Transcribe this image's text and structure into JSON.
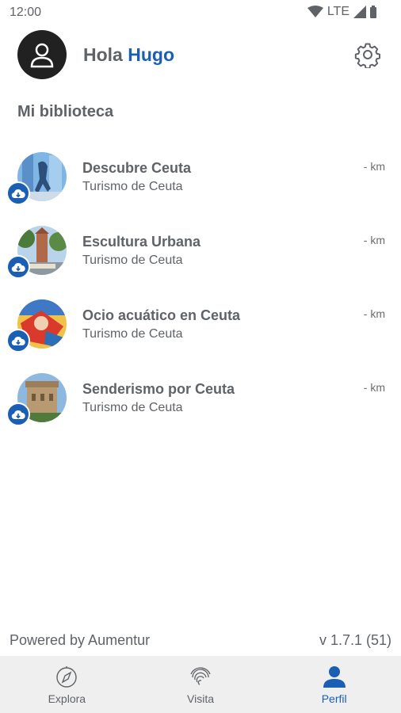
{
  "status": {
    "time": "12:00",
    "network": "LTE"
  },
  "header": {
    "greeting": "Hola",
    "user_name": "Hugo"
  },
  "library": {
    "title": "Mi biblioteca",
    "items": [
      {
        "title": "Descubre Ceuta",
        "subtitle": "Turismo de Ceuta",
        "distance": "- km"
      },
      {
        "title": "Escultura Urbana",
        "subtitle": "Turismo de Ceuta",
        "distance": "- km"
      },
      {
        "title": "Ocio acuático en Ceuta",
        "subtitle": "Turismo de Ceuta",
        "distance": "- km"
      },
      {
        "title": "Senderismo por Ceuta",
        "subtitle": "Turismo de Ceuta",
        "distance": "- km"
      }
    ]
  },
  "footer": {
    "powered_by": "Powered by Aumentur",
    "version": "v 1.7.1 (51)"
  },
  "tabs": [
    {
      "label": "Explora",
      "icon": "compass-icon",
      "active": false
    },
    {
      "label": "Visita",
      "icon": "fingerprint-icon",
      "active": false
    },
    {
      "label": "Perfil",
      "icon": "person-icon",
      "active": true
    }
  ],
  "colors": {
    "accent": "#1a5fb4",
    "text": "#5f6368",
    "tabbar_bg": "#efefef"
  }
}
